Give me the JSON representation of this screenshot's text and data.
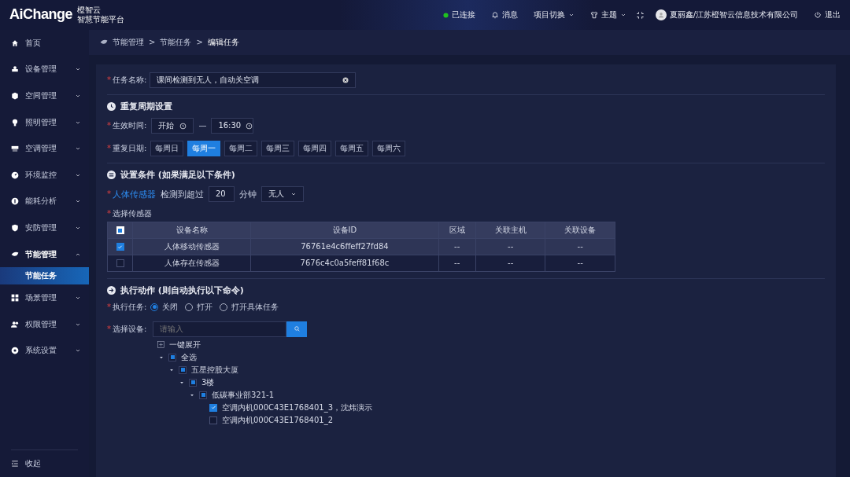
{
  "header": {
    "logo": "AiChange",
    "brand_line1": "橙智云",
    "brand_line2": "智慧节能平台",
    "status": "已连接",
    "messages": "消息",
    "project_switch": "项目切换",
    "theme": "主题",
    "user": "夏丽鑫/江苏橙智云信息技术有限公司",
    "logout": "退出"
  },
  "sidebar": {
    "items": [
      {
        "label": "首页"
      },
      {
        "label": "设备管理",
        "expanded": false
      },
      {
        "label": "空间管理",
        "expanded": false
      },
      {
        "label": "照明管理",
        "expanded": false
      },
      {
        "label": "空调管理",
        "expanded": false
      },
      {
        "label": "环境监控",
        "expanded": false
      },
      {
        "label": "能耗分析",
        "expanded": false
      },
      {
        "label": "安防管理",
        "expanded": false
      },
      {
        "label": "节能管理",
        "expanded": true,
        "children": [
          {
            "label": "节能任务",
            "selected": true
          }
        ]
      },
      {
        "label": "场景管理",
        "expanded": false
      },
      {
        "label": "权限管理",
        "expanded": false
      },
      {
        "label": "系统设置",
        "expanded": false
      }
    ],
    "collapse": "收起"
  },
  "breadcrumb": {
    "items": [
      "节能管理",
      "节能任务",
      "编辑任务"
    ],
    "separators": [
      ">",
      ">"
    ]
  },
  "form": {
    "task_name": {
      "required_mark": "*",
      "label": "任务名称:",
      "value": "课间检测到无人，自动关空调"
    },
    "repeat_section": {
      "title": "重复周期设置",
      "time_required_mark": "*",
      "time_label": "生效时间:",
      "start": "开始",
      "end": "16:30",
      "dash": "—",
      "days_required_mark": "*",
      "days_label": "重复日期:",
      "days": [
        {
          "label": "每周日",
          "selected": false
        },
        {
          "label": "每周一",
          "selected": true
        },
        {
          "label": "每周二",
          "selected": false
        },
        {
          "label": "每周三",
          "selected": false
        },
        {
          "label": "每周四",
          "selected": false
        },
        {
          "label": "每周五",
          "selected": false
        },
        {
          "label": "每周六",
          "selected": false
        }
      ]
    },
    "condition_section": {
      "title": "设置条件 (如果满足以下条件)",
      "sensor_required_mark": "*",
      "sensor_link": "人体传感器",
      "detect_text": "检测到超过",
      "minutes": "20",
      "minutes_unit": "分钟",
      "state_select": "无人",
      "table_required_mark": "*",
      "table_label": "选择传感器",
      "table": {
        "header_checked": false,
        "header_indeterminate": true,
        "columns": [
          "设备名称",
          "设备ID",
          "区域",
          "关联主机",
          "关联设备"
        ],
        "rows": [
          {
            "checked": true,
            "selected": true,
            "cells": [
              "人体移动传感器",
              "76761e4c6ffeff27fd84",
              "--",
              "--",
              "--"
            ]
          },
          {
            "checked": false,
            "selected": false,
            "cells": [
              "人体存在传感器",
              "7676c4c0a5feff81f68c",
              "--",
              "--",
              "--"
            ]
          }
        ]
      }
    },
    "action_section": {
      "title": "执行动作 (则自动执行以下命令)",
      "task_required_mark": "*",
      "task_label": "执行任务:",
      "options": [
        {
          "label": "关闭",
          "selected": true
        },
        {
          "label": "打开",
          "selected": false
        },
        {
          "label": "打开具体任务",
          "selected": false
        }
      ],
      "device_required_mark": "*",
      "device_label": "选择设备:",
      "search": {
        "placeholder": "请输入"
      },
      "expand_all": "一键展开",
      "tree": [
        {
          "label": "全选",
          "indeterminate": true,
          "expanded": true,
          "children": [
            {
              "label": "五星控股大厦",
              "indeterminate": true,
              "expanded": true,
              "children": [
                {
                  "label": "3楼",
                  "indeterminate": true,
                  "expanded": true,
                  "children": [
                    {
                      "label": "低碳事业部321-1",
                      "indeterminate": true,
                      "expanded": true,
                      "children": [
                        {
                          "label": "空调内机000C43E1768401_3，沈炜演示",
                          "checked": true
                        },
                        {
                          "label": "空调内机000C43E1768401_2",
                          "checked": false
                        }
                      ]
                    }
                  ]
                }
              ]
            }
          ]
        }
      ]
    }
  }
}
